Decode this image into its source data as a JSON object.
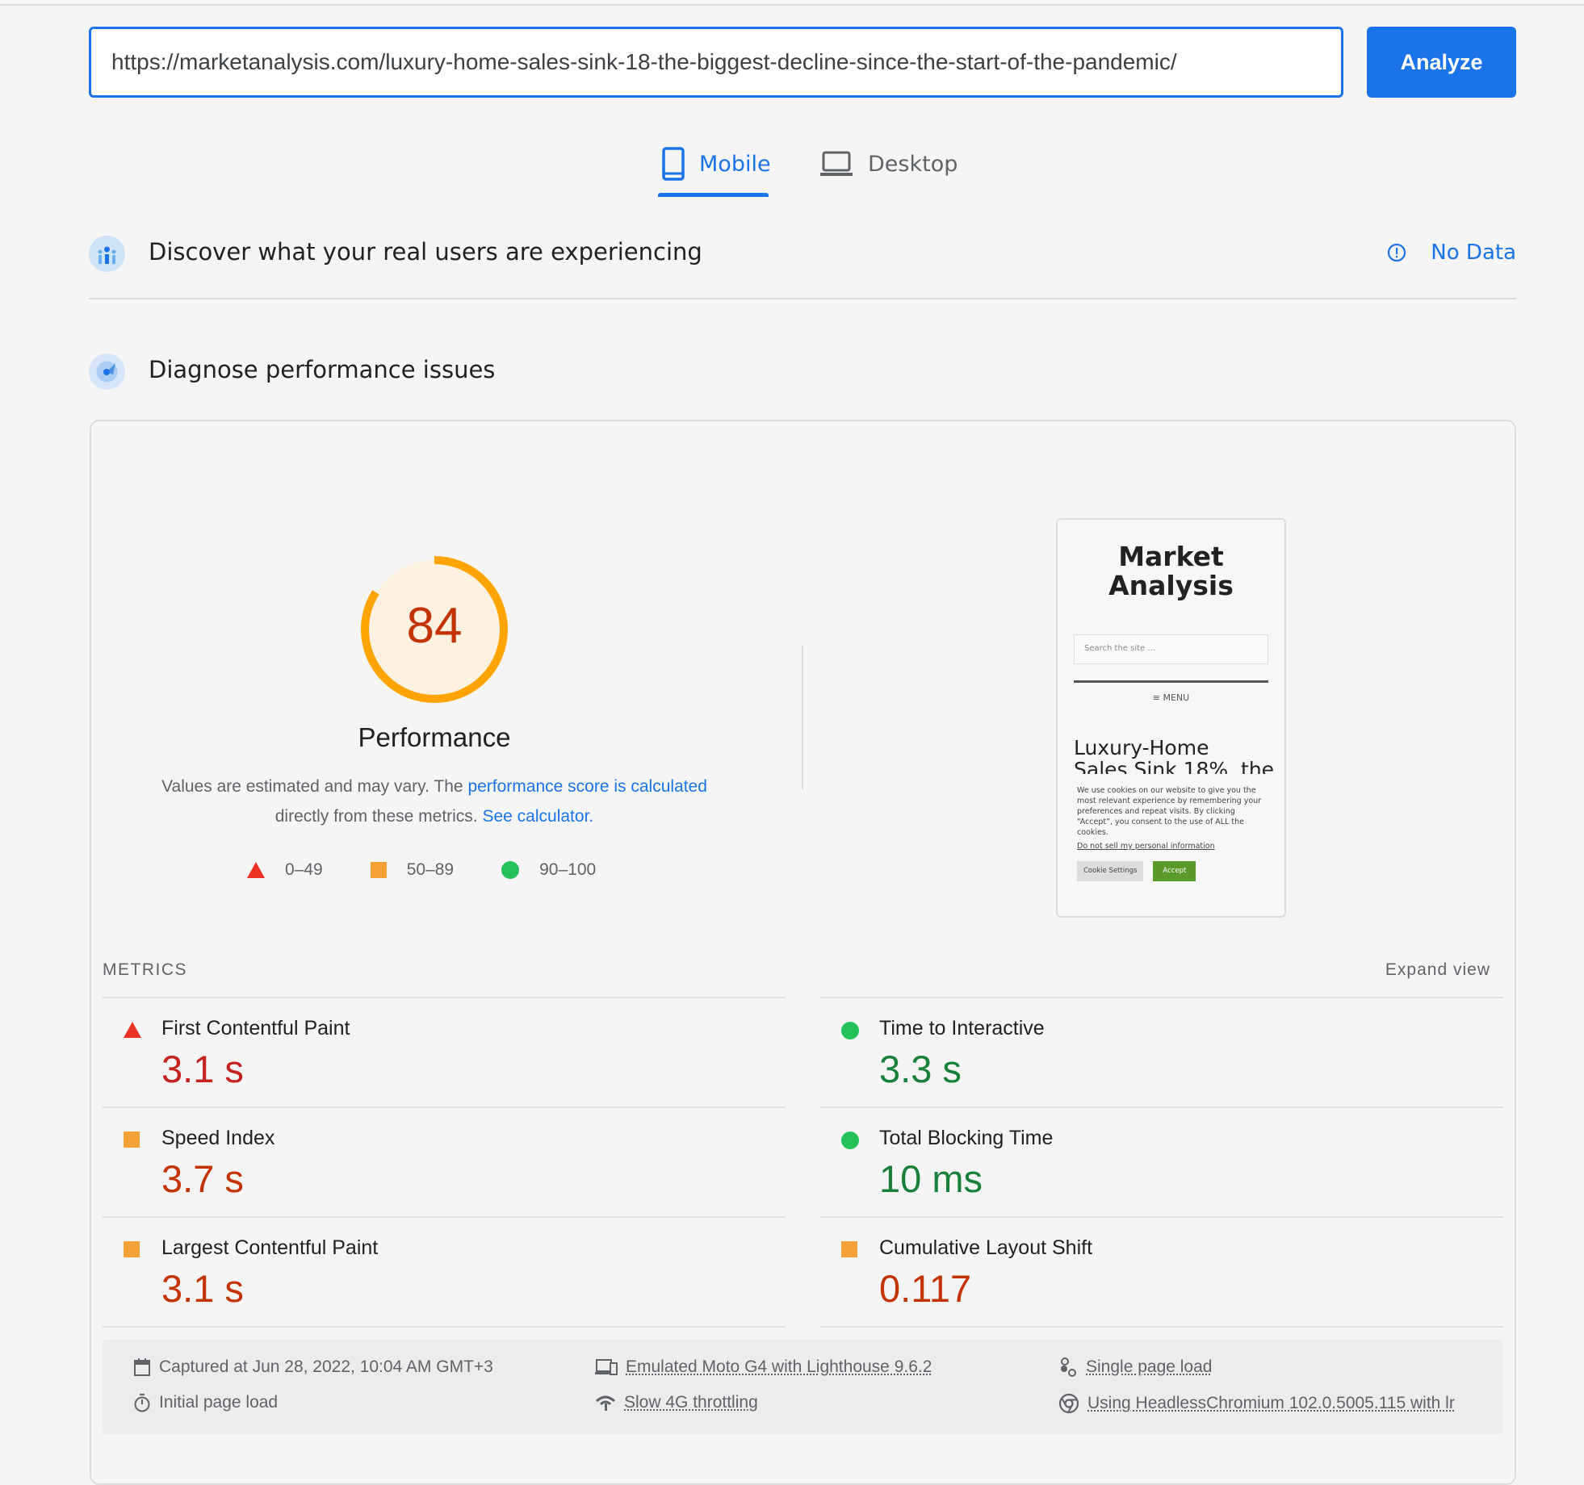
{
  "url_input": {
    "value": "https://marketanalysis.com/luxury-home-sales-sink-18-the-biggest-decline-since-the-start-of-the-pandemic/"
  },
  "analyze_label": "Analyze",
  "tabs": [
    {
      "label": "Mobile",
      "icon": "phone-icon",
      "active": true
    },
    {
      "label": "Desktop",
      "icon": "laptop-icon",
      "active": false
    }
  ],
  "field_data": {
    "title": "Discover what your real users are experiencing",
    "status": "No Data"
  },
  "lab": {
    "title": "Diagnose performance issues"
  },
  "score": {
    "value": 84,
    "fraction": 0.84,
    "label": "Performance",
    "color": "#ffa400"
  },
  "description": {
    "prefix": "Values are estimated and may vary. The ",
    "link1": "performance score is calculated",
    "middle": "directly from these metrics. ",
    "link2": "See calculator."
  },
  "legend": [
    {
      "range": "0–49",
      "shape": "triangle",
      "color": "#eb3323"
    },
    {
      "range": "50–89",
      "shape": "square",
      "color": "#f4a235"
    },
    {
      "range": "90–100",
      "shape": "circle",
      "color": "#24c15b"
    }
  ],
  "thumbnail": {
    "site_title_line1": "Market",
    "site_title_line2": "Analysis",
    "search_placeholder": "Search the site ...",
    "menu": "MENU",
    "headline_line1": "Luxury-Home",
    "headline_line2": "Sales Sink 18%, the",
    "cookie_text": "We use cookies on our website to give you the most relevant experience by remembering your preferences and repeat visits. By clicking “Accept”, you consent to the use of ALL the cookies.",
    "cookie_link": "Do not sell my personal information",
    "cookie_settings": "Cookie Settings",
    "accept": "Accept"
  },
  "metrics_heading": "METRICS",
  "expand_view": "Expand view",
  "metrics": [
    {
      "label": "First Contentful Paint",
      "value": "3.1 s",
      "rating": "poor",
      "color": "#c5221f"
    },
    {
      "label": "Time to Interactive",
      "value": "3.3 s",
      "rating": "good",
      "color": "#188038"
    },
    {
      "label": "Speed Index",
      "value": "3.7 s",
      "rating": "average",
      "color": "#c33300"
    },
    {
      "label": "Total Blocking Time",
      "value": "10 ms",
      "rating": "good",
      "color": "#188038"
    },
    {
      "label": "Largest Contentful Paint",
      "value": "3.1 s",
      "rating": "average",
      "color": "#c33300"
    },
    {
      "label": "Cumulative Layout Shift",
      "value": "0.117",
      "rating": "average",
      "color": "#c33300"
    }
  ],
  "footer": {
    "captured": "Captured at Jun 28, 2022, 10:04 AM GMT+3",
    "emulated": "Emulated Moto G4 with Lighthouse 9.6.2",
    "single": "Single page load",
    "initial": "Initial page load",
    "throttling": "Slow 4G throttling",
    "browser": "Using HeadlessChromium 102.0.5005.115 with lr"
  }
}
